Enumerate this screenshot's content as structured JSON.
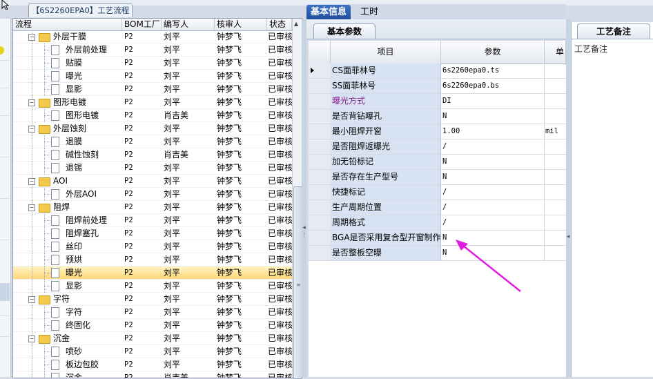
{
  "window_tab": "【6S2260EPA0】工艺流程",
  "tree": {
    "columns": [
      "流程",
      "BOM工厂",
      "编写人",
      "核审人",
      "状态"
    ],
    "rows": [
      {
        "name": "外层干膜",
        "level": 1,
        "type": "folder",
        "factory": "P2",
        "writer": "刘平",
        "reviewer": "钟梦飞",
        "status": "已审核"
      },
      {
        "name": "外层前处理",
        "level": 2,
        "type": "doc",
        "factory": "P2",
        "writer": "刘平",
        "reviewer": "钟梦飞",
        "status": "已审核"
      },
      {
        "name": "贴膜",
        "level": 2,
        "type": "doc",
        "factory": "P2",
        "writer": "刘平",
        "reviewer": "钟梦飞",
        "status": "已审核"
      },
      {
        "name": "曝光",
        "level": 2,
        "type": "doc",
        "factory": "P2",
        "writer": "刘平",
        "reviewer": "钟梦飞",
        "status": "已审核"
      },
      {
        "name": "显影",
        "level": 2,
        "type": "doc",
        "factory": "P2",
        "writer": "刘平",
        "reviewer": "钟梦飞",
        "status": "已审核"
      },
      {
        "name": "图形电镀",
        "level": 1,
        "type": "folder",
        "factory": "P2",
        "writer": "刘平",
        "reviewer": "钟梦飞",
        "status": "已审核"
      },
      {
        "name": "图形电镀",
        "level": 2,
        "type": "doc",
        "factory": "P2",
        "writer": "肖吉美",
        "reviewer": "钟梦飞",
        "status": "已审核"
      },
      {
        "name": "外层蚀刻",
        "level": 1,
        "type": "folder",
        "factory": "P2",
        "writer": "刘平",
        "reviewer": "钟梦飞",
        "status": "已审核"
      },
      {
        "name": "退膜",
        "level": 2,
        "type": "doc",
        "factory": "P2",
        "writer": "刘平",
        "reviewer": "钟梦飞",
        "status": "已审核"
      },
      {
        "name": "碱性蚀刻",
        "level": 2,
        "type": "doc",
        "factory": "P2",
        "writer": "肖吉美",
        "reviewer": "钟梦飞",
        "status": "已审核"
      },
      {
        "name": "退锡",
        "level": 2,
        "type": "doc",
        "factory": "P2",
        "writer": "刘平",
        "reviewer": "钟梦飞",
        "status": "已审核"
      },
      {
        "name": "AOI",
        "level": 1,
        "type": "folder",
        "factory": "P2",
        "writer": "刘平",
        "reviewer": "钟梦飞",
        "status": "已审核"
      },
      {
        "name": "外层AOI",
        "level": 2,
        "type": "doc",
        "factory": "P2",
        "writer": "刘平",
        "reviewer": "钟梦飞",
        "status": "已审核"
      },
      {
        "name": "阻焊",
        "level": 1,
        "type": "folder",
        "factory": "P2",
        "writer": "刘平",
        "reviewer": "钟梦飞",
        "status": "已审核"
      },
      {
        "name": "阻焊前处理",
        "level": 2,
        "type": "doc",
        "factory": "P2",
        "writer": "刘平",
        "reviewer": "钟梦飞",
        "status": "已审核"
      },
      {
        "name": "阻焊塞孔",
        "level": 2,
        "type": "doc",
        "factory": "P2",
        "writer": "刘平",
        "reviewer": "钟梦飞",
        "status": "已审核"
      },
      {
        "name": "丝印",
        "level": 2,
        "type": "doc",
        "factory": "P2",
        "writer": "刘平",
        "reviewer": "钟梦飞",
        "status": "已审核"
      },
      {
        "name": "预烘",
        "level": 2,
        "type": "doc",
        "factory": "P2",
        "writer": "刘平",
        "reviewer": "钟梦飞",
        "status": "已审核"
      },
      {
        "name": "曝光",
        "level": 2,
        "type": "doc",
        "factory": "P2",
        "writer": "刘平",
        "reviewer": "钟梦飞",
        "status": "已审核",
        "selected": true
      },
      {
        "name": "显影",
        "level": 2,
        "type": "doc",
        "factory": "P2",
        "writer": "刘平",
        "reviewer": "钟梦飞",
        "status": "已审核"
      },
      {
        "name": "字符",
        "level": 1,
        "type": "folder",
        "factory": "P2",
        "writer": "刘平",
        "reviewer": "钟梦飞",
        "status": "已审核"
      },
      {
        "name": "字符",
        "level": 2,
        "type": "doc",
        "factory": "P2",
        "writer": "刘平",
        "reviewer": "钟梦飞",
        "status": "已审核"
      },
      {
        "name": "终固化",
        "level": 2,
        "type": "doc",
        "factory": "P2",
        "writer": "刘平",
        "reviewer": "钟梦飞",
        "status": "已审核"
      },
      {
        "name": "沉金",
        "level": 1,
        "type": "folder",
        "factory": "P2",
        "writer": "刘平",
        "reviewer": "钟梦飞",
        "status": "已审核"
      },
      {
        "name": "喷砂",
        "level": 2,
        "type": "doc",
        "factory": "P2",
        "writer": "刘平",
        "reviewer": "钟梦飞",
        "status": "已审核"
      },
      {
        "name": "板边包胶",
        "level": 2,
        "type": "doc",
        "factory": "P2",
        "writer": "刘平",
        "reviewer": "钟梦飞",
        "status": "已审核"
      },
      {
        "name": "沉金",
        "level": 2,
        "type": "doc",
        "factory": "P2",
        "writer": "肖吉美",
        "reviewer": "钟梦飞",
        "status": "已审核"
      }
    ]
  },
  "tabs": {
    "basic_info": "基本信息",
    "working_hours": "工时"
  },
  "params": {
    "subtab": "基本参数",
    "columns": {
      "item": "项目",
      "param": "参数",
      "unit": "单"
    },
    "rows": [
      {
        "item": "CS面菲林号",
        "value": "6s2260epa0.ts",
        "unit": "",
        "current": true
      },
      {
        "item": "SS面菲林号",
        "value": "6s2260epa0.bs",
        "unit": ""
      },
      {
        "item": "曝光方式",
        "value": "DI",
        "unit": "",
        "color": "#8a1a8a"
      },
      {
        "item": "是否背钻曝孔",
        "value": "N",
        "unit": ""
      },
      {
        "item": "最小阻焊开窗",
        "value": "1.00",
        "unit": "mil"
      },
      {
        "item": "是否阻焊返曝光",
        "value": "/",
        "unit": ""
      },
      {
        "item": "加无铅标记",
        "value": "N",
        "unit": ""
      },
      {
        "item": "是否存在生产型号",
        "value": "N",
        "unit": ""
      },
      {
        "item": "快捷标记",
        "value": "/",
        "unit": ""
      },
      {
        "item": "生产周期位置",
        "value": "/",
        "unit": ""
      },
      {
        "item": "周期格式",
        "value": "/",
        "unit": ""
      },
      {
        "item": "BGA是否采用复合型开窗制作",
        "value": "N",
        "unit": ""
      },
      {
        "item": "是否整板空曝",
        "value": "N",
        "unit": ""
      }
    ]
  },
  "notes": {
    "tab": "工艺备注",
    "label": "工艺备注"
  },
  "annotation_color": "#e21be0"
}
